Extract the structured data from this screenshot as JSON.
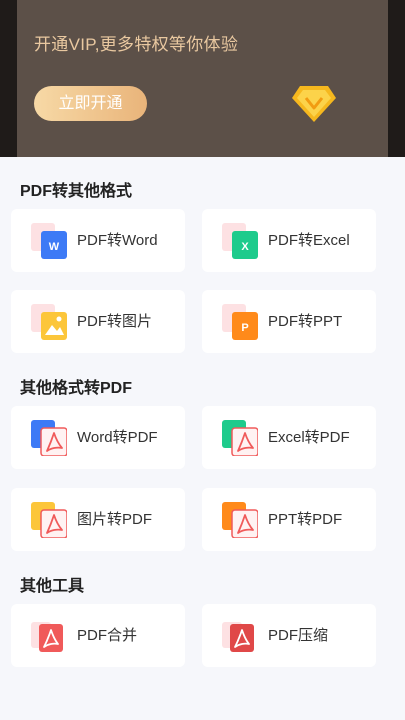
{
  "vip": {
    "title": "开通VIP,更多特权等你体验",
    "button_label": "立即开通"
  },
  "sections": [
    {
      "title": "PDF转其他格式",
      "items": [
        {
          "label": "PDF转Word",
          "icon": "pdf-to-word-icon",
          "color": "#3d7af6"
        },
        {
          "label": "PDF转Excel",
          "icon": "pdf-to-excel-icon",
          "color": "#1ecb8c"
        },
        {
          "label": "PDF转图片",
          "icon": "pdf-to-image-icon",
          "color": "#fcc63a"
        },
        {
          "label": "PDF转PPT",
          "icon": "pdf-to-ppt-icon",
          "color": "#ff8a1a"
        }
      ]
    },
    {
      "title": "其他格式转PDF",
      "items": [
        {
          "label": "Word转PDF",
          "icon": "word-to-pdf-icon",
          "color": "#3d7af6"
        },
        {
          "label": "Excel转PDF",
          "icon": "excel-to-pdf-icon",
          "color": "#1ecb8c"
        },
        {
          "label": "图片转PDF",
          "icon": "image-to-pdf-icon",
          "color": "#fcc63a"
        },
        {
          "label": "PPT转PDF",
          "icon": "ppt-to-pdf-icon",
          "color": "#ff8a1a"
        }
      ]
    },
    {
      "title": "其他工具",
      "items": [
        {
          "label": "PDF合并",
          "icon": "pdf-merge-icon",
          "color": "#f05a5a"
        },
        {
          "label": "PDF压缩",
          "icon": "pdf-compress-icon",
          "color": "#e04848"
        }
      ]
    }
  ],
  "colors": {
    "pdf_red": "#f05a5a",
    "vip_gold": "#e9c8a0",
    "vip_card": "#5c5048"
  }
}
